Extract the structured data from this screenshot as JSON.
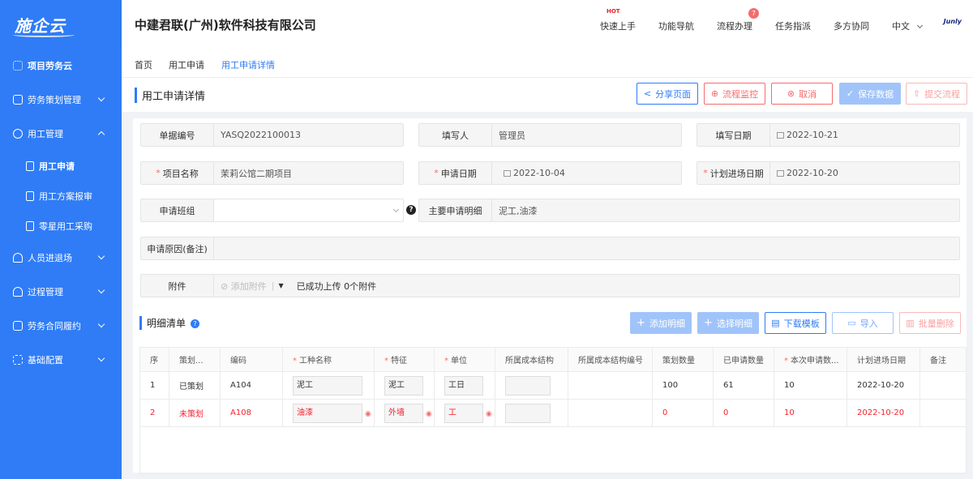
{
  "sidebar": {
    "logo": "施企云",
    "items": [
      {
        "label": "项目劳务云",
        "icon": "grid-icon"
      },
      {
        "label": "劳务策划管理",
        "icon": "plan-icon"
      },
      {
        "label": "用工管理",
        "icon": "labor-icon"
      },
      {
        "label": "用工申请",
        "icon": "doc-icon"
      },
      {
        "label": "用工方案报审",
        "icon": "review-icon"
      },
      {
        "label": "零星用工采购",
        "icon": "purchase-icon"
      },
      {
        "label": "人员进退场",
        "icon": "person-icon"
      },
      {
        "label": "过程管理",
        "icon": "process-icon"
      },
      {
        "label": "劳务合同履约",
        "icon": "contract-icon"
      },
      {
        "label": "基础配置",
        "icon": "config-icon"
      }
    ]
  },
  "header": {
    "company": "中建君联(广州)软件科技有限公司",
    "nav": {
      "quick": "快速上手",
      "hot": "HOT",
      "func": "功能导航",
      "flow": "流程办理",
      "flow_badge": "7",
      "task": "任务指派",
      "collab": "多方协同",
      "lang": "中文",
      "brand": "Junly"
    }
  },
  "breadcrumbs": {
    "home": "首页",
    "apply": "用工申请",
    "detail": "用工申请详情"
  },
  "page": {
    "title": "用工申请详情",
    "buttons": {
      "share": "分享页面",
      "monitor": "流程监控",
      "cancel": "取消",
      "save": "保存数据",
      "submit": "提交流程"
    }
  },
  "form": {
    "doc_no": {
      "label": "单据编号",
      "value": "YASQ2022100013"
    },
    "writer": {
      "label": "填写人",
      "value": "管理员"
    },
    "write_date": {
      "label": "填写日期",
      "value": "2022-10-21"
    },
    "project": {
      "label": "项目名称",
      "value": "茉莉公馆二期项目"
    },
    "apply_date": {
      "label": "申请日期",
      "value": "2022-10-04"
    },
    "plan_date": {
      "label": "计划进场日期",
      "value": "2022-10-20"
    },
    "team": {
      "label": "申请班组",
      "value": ""
    },
    "detail": {
      "label": "主要申请明细",
      "value": "泥工,油漆"
    },
    "reason": {
      "label": "申请原因(备注)",
      "value": ""
    },
    "attach": {
      "label": "附件",
      "add": "添加附件",
      "status": "已成功上传 0个附件"
    }
  },
  "detail_list": {
    "title": "明细清单",
    "buttons": {
      "add": "添加明细",
      "select": "选择明细",
      "download": "下载模板",
      "import": "导入",
      "batch_delete": "批量删除"
    },
    "columns": [
      "序",
      "策划...",
      "编码",
      "工种名称",
      "特征",
      "单位",
      "所属成本结构",
      "所属成本结构编号",
      "策划数量",
      "已申请数量",
      "本次申请数...",
      "计划进场日期",
      "备注"
    ],
    "rows": [
      {
        "seq": "1",
        "plan": "已策划",
        "code": "A104",
        "type": "泥工",
        "feature": "泥工",
        "unit": "工日",
        "cost": "",
        "cost_no": "",
        "plan_qty": "100",
        "applied": "61",
        "current": "10",
        "date": "2022-10-20",
        "remark": ""
      },
      {
        "seq": "2",
        "plan": "未策划",
        "code": "A108",
        "type": "油漆",
        "feature": "外墙",
        "unit": "工",
        "cost": "",
        "cost_no": "",
        "plan_qty": "0",
        "applied": "0",
        "current": "10",
        "date": "2022-10-20",
        "remark": ""
      }
    ]
  },
  "colors": {
    "primary": "#2f7cf6",
    "danger": "#f56c6c"
  }
}
